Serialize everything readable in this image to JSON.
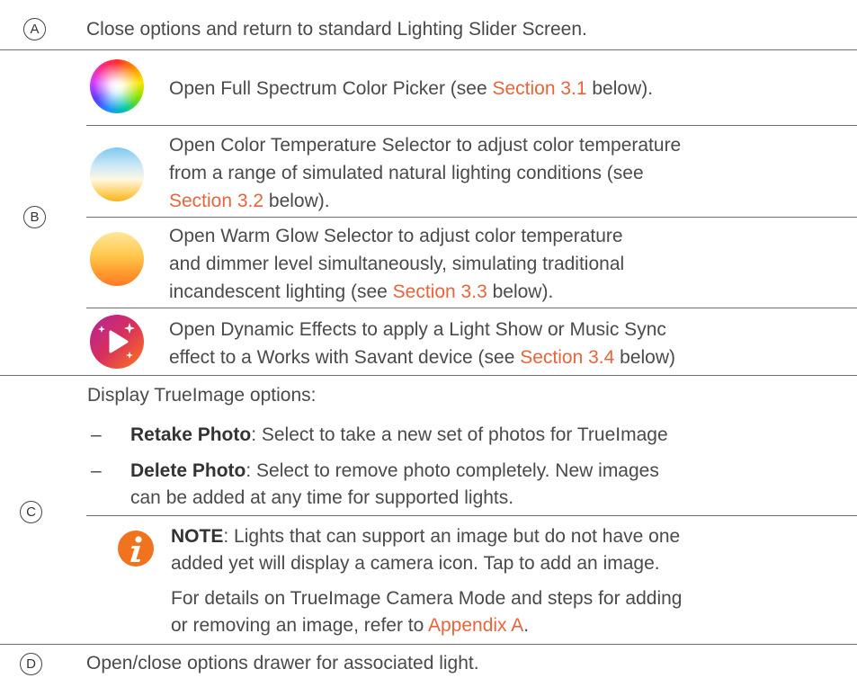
{
  "rows": {
    "a": {
      "label": "A",
      "text": "Close options and return to standard Lighting Slider Screen."
    },
    "b": {
      "label": "B",
      "items": [
        {
          "icon": "full-spectrum-icon",
          "pre": "Open Full Spectrum Color Picker (see ",
          "link": "Section 3.1",
          "post": " below)."
        },
        {
          "icon": "color-temperature-icon",
          "line1": "Open Color Temperature Selector to adjust color temperature",
          "line2": "from a range of simulated natural lighting conditions (see",
          "link": "Section 3.2",
          "post": " below)."
        },
        {
          "icon": "warm-glow-icon",
          "line1": "Open Warm Glow Selector to adjust color temperature",
          "line2": "and dimmer level simultaneously, simulating traditional",
          "pre3": "incandescent lighting (see ",
          "link": "Section 3.3",
          "post": " below)."
        },
        {
          "icon": "dynamic-effects-icon",
          "line1": "Open Dynamic Effects to apply a Light Show or Music Sync",
          "pre2": "effect to a Works with Savant device (see ",
          "link": "Section 3.4",
          "post": " below)"
        }
      ]
    },
    "c": {
      "label": "C",
      "intro": "Display TrueImage options:",
      "bullet1": {
        "dash": "–",
        "term": "Retake Photo",
        "text": ": Select to take a new set of photos for TrueImage"
      },
      "bullet2": {
        "dash": "–",
        "term": "Delete Photo",
        "text1": ": Select to remove photo completely. New images",
        "text2": "can be added at any time for supported lights."
      },
      "note": {
        "icon": "info-icon",
        "label": "NOTE",
        "line1": ": Lights that can support an image but do not have one",
        "line2": "added yet will display a camera icon. Tap to add an image.",
        "line3": "For details on TrueImage Camera Mode and steps for adding",
        "pre4": "or removing an image, refer to ",
        "link": "Appendix A",
        "post": "."
      }
    },
    "d": {
      "label": "D",
      "text": "Open/close options drawer for associated light."
    }
  },
  "colors": {
    "text": "#4a4a4a",
    "link": "#e8643a",
    "divider": "#707070",
    "note_icon": "#f1731f"
  }
}
